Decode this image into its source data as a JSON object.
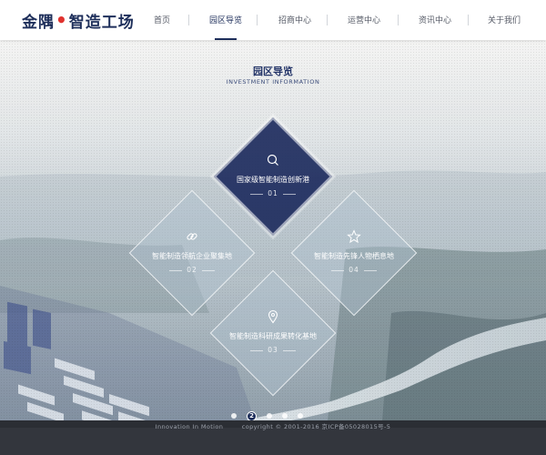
{
  "brand": {
    "name_part1": "金隅",
    "separator": "•",
    "name_part2": "智造工场",
    "accent_color": "#e0322e",
    "primary_color": "#1d2e5a"
  },
  "nav": {
    "items": [
      {
        "label": "首页",
        "active": false
      },
      {
        "label": "园区导览",
        "active": true
      },
      {
        "label": "招商中心",
        "active": false
      },
      {
        "label": "运营中心",
        "active": false
      },
      {
        "label": "资讯中心",
        "active": false
      },
      {
        "label": "关于我们",
        "active": false
      }
    ]
  },
  "section": {
    "title": "园区导览",
    "subtitle": "INVESTMENT INFORMATION"
  },
  "diamonds": [
    {
      "label": "国家级智能制造创新港",
      "number": "01",
      "icon": "search-icon",
      "active": true
    },
    {
      "label": "智能制造领航企业聚集地",
      "number": "02",
      "icon": "link-icon",
      "active": false
    },
    {
      "label": "智能制造科研成果转化基地",
      "number": "03",
      "icon": "location-pin-icon",
      "active": false
    },
    {
      "label": "智能制造先锋人物栖息地",
      "number": "04",
      "icon": "star-icon",
      "active": false
    }
  ],
  "pager": {
    "count": 5,
    "active_index": 1,
    "active_label": "2"
  },
  "footer": {
    "slogan": "Innovation In Motion",
    "copyright": "copyright © 2001-2016 京ICP备05028015号-5"
  }
}
